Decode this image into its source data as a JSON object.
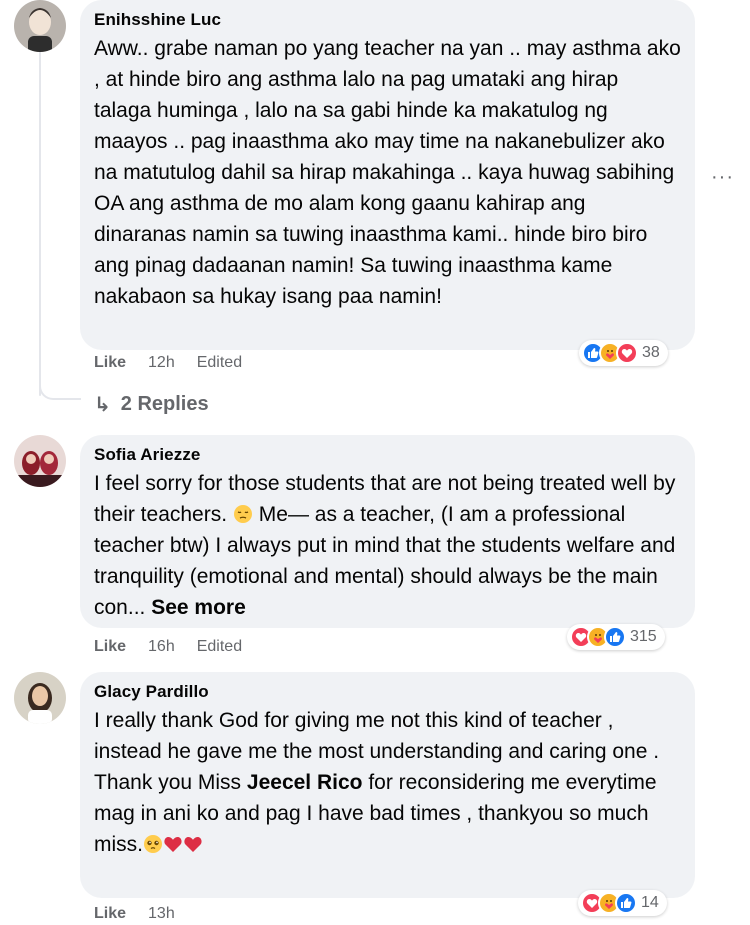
{
  "comments": [
    {
      "author": "Enihsshine Luc",
      "text": "Aww.. grabe naman po yang teacher na yan .. may asthma ako , at hinde biro ang asthma lalo na pag umataki ang hirap talaga huminga , lalo na sa gabi hinde ka makatulog ng maayos .. pag inaasthma ako may time na nakanebulizer ako na matutulog dahil sa hirap makahinga .. kaya huwag sabihing OA ang asthma de mo alam kong gaanu kahirap ang dinaranas namin sa tuwing inaasthma kami.. hinde biro biro ang pinag dadaanan namin! Sa tuwing inaasthma kame nakabaon sa hukay isang paa namin!",
      "like_label": "Like",
      "time": "12h",
      "edited": "Edited",
      "reaction_icons": [
        "like",
        "care",
        "love"
      ],
      "reaction_count": "38",
      "more_options": "···",
      "replies_label": "2 Replies"
    },
    {
      "author": "Sofia Ariezze",
      "text_before_emoji": "I feel sorry for those students that are not being treated well by their teachers.",
      "inline_emoji": "pensive-face",
      "text_after_emoji": "Me— as a teacher, (I am a professional teacher btw) I always put in mind that the students welfare and tranquility (emotional and mental) should always be the main con...",
      "see_more": "See more",
      "like_label": "Like",
      "time": "16h",
      "edited": "Edited",
      "reaction_icons": [
        "love",
        "care",
        "like"
      ],
      "reaction_count": "315"
    },
    {
      "author": "Glacy Pardillo",
      "text_part1": "I really thank God for giving me not this kind of teacher , instead he gave me the most understanding and caring one .",
      "text_part2_before": "Thank you Miss",
      "mention": "Jeecel Rico",
      "text_part2_after": "for reconsidering me everytime mag in ani ko and pag I have bad times , thankyou so much miss.",
      "trailing_emojis": [
        "pleading-face",
        "red-heart",
        "red-heart"
      ],
      "like_label": "Like",
      "time": "13h",
      "reaction_icons": [
        "love",
        "care",
        "like"
      ],
      "reaction_count": "14"
    }
  ],
  "colors": {
    "bubble_bg": "#f0f2f5",
    "meta_text": "#65676b",
    "like_blue": "#1877f2",
    "love_red": "#f33e58",
    "care_yellow": "#f7b125"
  }
}
